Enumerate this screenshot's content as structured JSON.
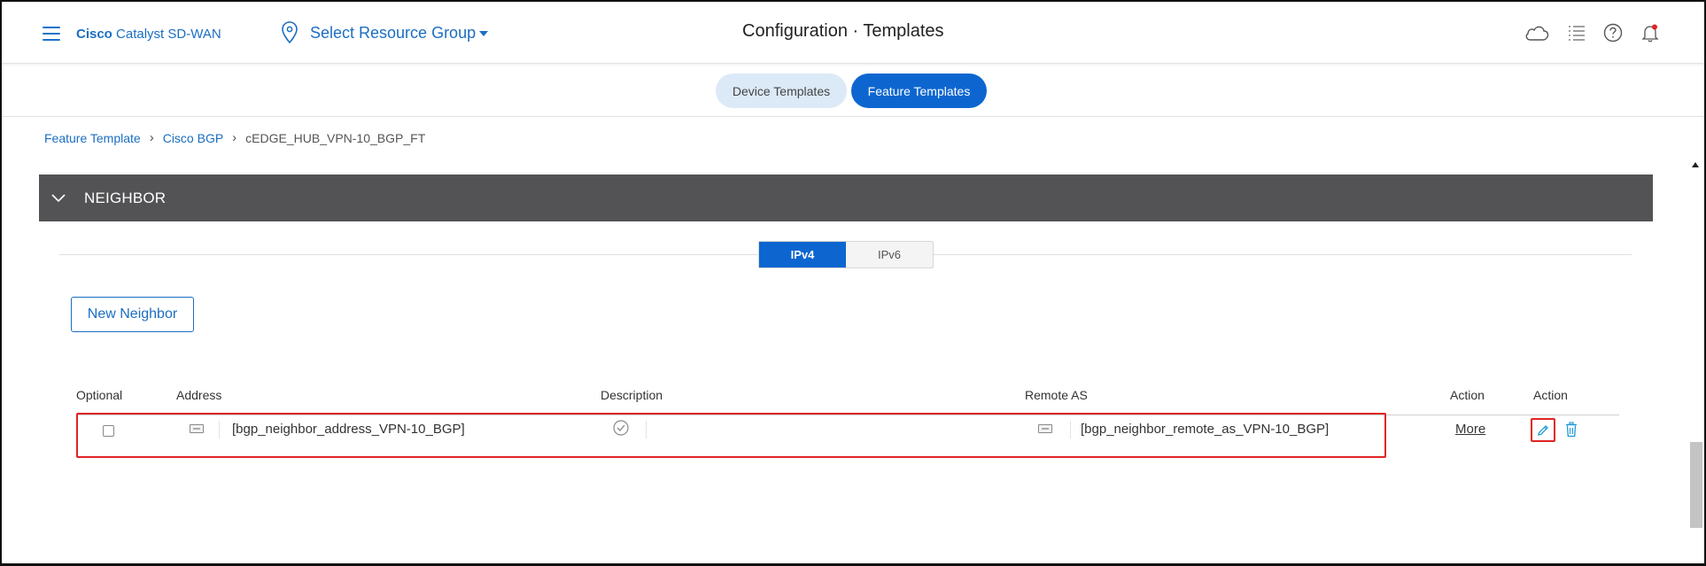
{
  "header": {
    "brand_bold": "Cisco",
    "brand_rest": " Catalyst SD-WAN",
    "resource_group": "Select Resource Group",
    "title": "Configuration · Templates",
    "icons": [
      "cloud-icon",
      "list-icon",
      "help-icon",
      "bell-icon"
    ]
  },
  "tabs": [
    {
      "label": "Device Templates",
      "active": false
    },
    {
      "label": "Feature Templates",
      "active": true
    }
  ],
  "breadcrumb": {
    "items": [
      "Feature Template",
      "Cisco BGP"
    ],
    "current": "cEDGE_HUB_VPN-10_BGP_FT"
  },
  "section": {
    "title": "NEIGHBOR",
    "expanded": true
  },
  "ip_toggle": {
    "options": [
      "IPv4",
      "IPv6"
    ],
    "selected": "IPv4"
  },
  "new_neighbor_label": "New Neighbor",
  "table": {
    "columns": [
      "Optional",
      "Address",
      "Description",
      "Remote AS",
      "Action",
      "Action"
    ],
    "rows": [
      {
        "optional": false,
        "address": "[bgp_neighbor_address_VPN-10_BGP]",
        "description": "",
        "remote_as": "[bgp_neighbor_remote_as_VPN-10_BGP]",
        "action_link": "More"
      }
    ]
  },
  "colors": {
    "accent": "#0d66d0",
    "link": "#1b6ec2",
    "section_bg": "#535355",
    "highlight": "#e02424",
    "trash": "#1b9ad6"
  }
}
